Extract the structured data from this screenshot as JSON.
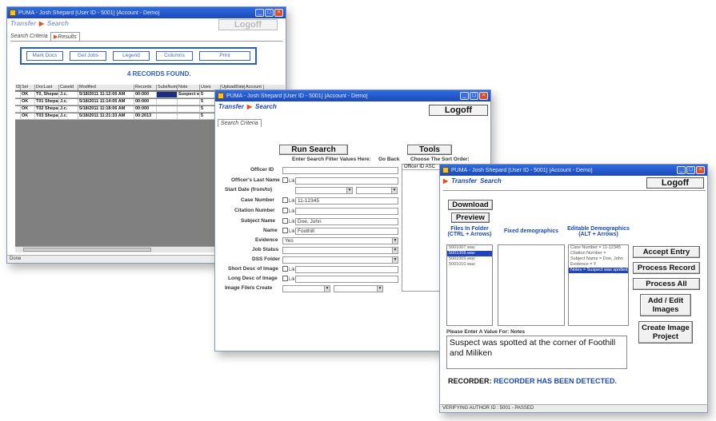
{
  "window_results": {
    "title": "PUMA - Josh Shepard [User ID - 5001] [Account - Demo]",
    "nav_transfer": "Transfer",
    "nav_search": "Search",
    "logoff": "Logoff",
    "tabs": [
      "Search Criteria",
      "Results"
    ],
    "buttons": [
      "Mark Docs",
      "Get Jobs",
      "Legend",
      "Columns",
      "Print"
    ],
    "records_found": "4 RECORDS FOUND.",
    "columns": [
      "ID",
      "Sel",
      "DocLast",
      "Caseld",
      "Modified",
      "Records",
      "SubsNum",
      "Note",
      "Uses",
      "UploadDate",
      "Account"
    ],
    "rows": [
      [
        "",
        "OK",
        "T0, Shepard",
        "J.c.",
        "5/18/2011 11:12:06 AM",
        "00:000",
        "",
        "Suspect was",
        "5"
      ],
      [
        "",
        "OK",
        "T01 Shepard",
        "J.c.",
        "5/18/2011 11:14:05 AM",
        "00:000",
        "",
        "",
        "5"
      ],
      [
        "",
        "OK",
        "T02 Shepard",
        "J.c.",
        "5/18/2011 11:18:06 AM",
        "00:000",
        "",
        "",
        "5"
      ],
      [
        "",
        "OK",
        "T03 Shepard",
        "J.c.",
        "5/18/2011 11:21:33 AM",
        "00:2013",
        "",
        "",
        "5"
      ]
    ],
    "status": "Done"
  },
  "window_search": {
    "title": "PUMA - Josh Shepard [User ID - 5001] [Account - Demo]",
    "nav_transfer": "Transfer",
    "nav_search": "Search",
    "logoff": "Logoff",
    "tab": "Search Criteria",
    "run_search": "Run Search",
    "tools": "Tools",
    "enter_values": "Enter Search Filter Values Here:",
    "go_back": "Go Back",
    "sort_order": "Choose The Sort Order:",
    "sort_value": "Officer ID ASC",
    "like": "Like",
    "fields": [
      {
        "label": "Officer ID",
        "value": ""
      },
      {
        "label": "Officer's Last Name",
        "value": ""
      },
      {
        "label": "Start Date (from/to)",
        "value": ""
      },
      {
        "label": "Case Number",
        "value": "11-12345"
      },
      {
        "label": "Citation Number",
        "value": ""
      },
      {
        "label": "Subject Name",
        "value": "Doe, John"
      },
      {
        "label": "Name",
        "value": "Foothill"
      },
      {
        "label": "Evidence",
        "value": "Yes"
      },
      {
        "label": "Job Status",
        "value": ""
      },
      {
        "label": "DSS Folder",
        "value": ""
      },
      {
        "label": "Short Desc of Image",
        "value": ""
      },
      {
        "label": "Long Desc of Image",
        "value": ""
      },
      {
        "label": "Image File/s Create",
        "value": ""
      }
    ]
  },
  "window_files": {
    "title": "PUMA - Josh Shepard [User ID - 5001] [Account - Demo]",
    "nav_transfer": "Transfer",
    "nav_search": "Search",
    "logoff": "Logoff",
    "download": "Download",
    "preview": "Preview",
    "files_head": "Files In Folder (CTRL + Arrows)",
    "fixed_head": "Fixed demographics",
    "editable_head": "Editable Demographics (ALT + Arrows)",
    "files": [
      "5001007.wav",
      "5001008.wav",
      "5001009.wav",
      "5001010.wav"
    ],
    "files_selected": 1,
    "fixed": [
      "",
      "",
      "",
      "",
      "",
      "",
      "",
      "",
      "",
      ""
    ],
    "editable": [
      "Case Number = 11-12345",
      "Citation Number =",
      "Subject Name = Doe, John",
      "Evidence = Y",
      "Notes = Suspect was spotted at the c"
    ],
    "editable_selected": 4,
    "actions": [
      "Accept Entry",
      "Process Record",
      "Process All",
      "Add / Edit Images",
      "Create Image Project"
    ],
    "notes_label": "Please Enter A Value For: Notes",
    "notes_value": "Suspect was spotted at the corner of Foothill and Miliken",
    "recorder_label": "RECORDER:",
    "recorder_value": "RECORDER HAS BEEN DETECTED.",
    "status": "VERIFYING AUTHOR ID : 5001 - PASSED"
  }
}
